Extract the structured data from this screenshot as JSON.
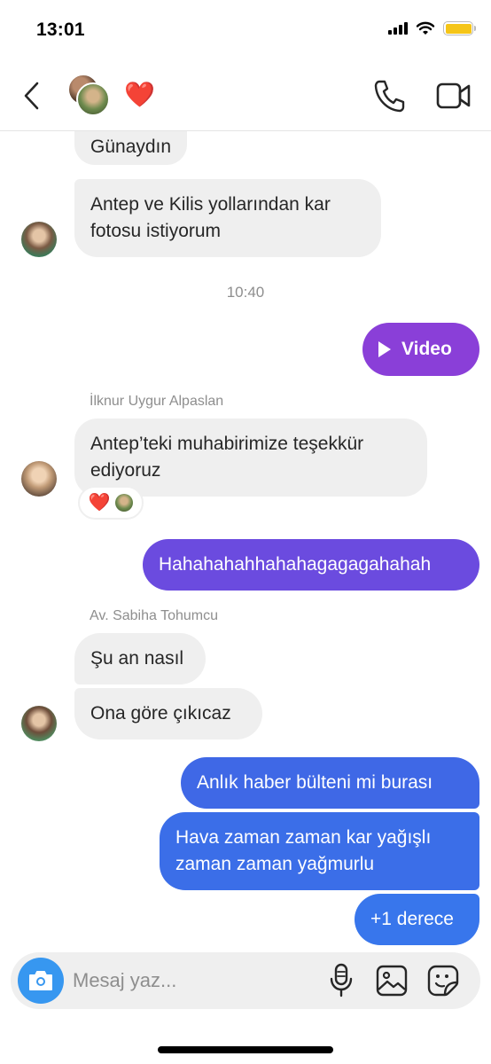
{
  "status_bar": {
    "time": "13:01"
  },
  "header": {
    "heart_emoji": "❤️"
  },
  "chat": {
    "messages": [
      {
        "text": "Günaydın"
      },
      {
        "text": "Antep ve Kilis yollarından kar fotosu istiyorum"
      },
      {
        "text": "Video"
      },
      {
        "text": "Antep’teki muhabirimize teşekkür ediyoruz"
      },
      {
        "text": "Hahahahahhahahagagagahahah"
      },
      {
        "text": "Şu an nasıl"
      },
      {
        "text": "Ona göre çıkıcaz"
      },
      {
        "text": "Anlık haber bülteni mi burası"
      },
      {
        "text": "Hava zaman zaman kar yağışlı zaman zaman yağmurlu"
      },
      {
        "text": "+1 derece"
      }
    ],
    "time_label": "10:40",
    "senders": [
      "İlknur Uygur Alpaslan",
      "Av. Sabiha Tohumcu"
    ],
    "reaction_emoji": "❤️"
  },
  "composer": {
    "placeholder": "Mesaj yaz..."
  },
  "colors": {
    "incoming_bubble": "#efefef",
    "video_bubble": "#8a3fd8",
    "purple_bubble": "#6b4bdf",
    "blue_bubble": "#3b6ee8",
    "camera_button": "#3797f0",
    "heart": "#e0202c"
  }
}
